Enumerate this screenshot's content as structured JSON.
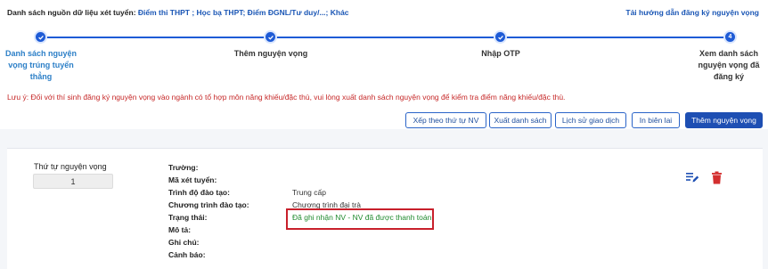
{
  "header": {
    "sources_label": "Danh sách nguồn dữ liệu xét tuyển:",
    "sources_value": "Điểm thi THPT ; Học bạ THPT; Điểm ĐGNL/Tư duy/...; Khác",
    "guide_link": "Tải hướng dẫn đăng ký nguyện vọng"
  },
  "steps": [
    {
      "label_lines": [
        "Danh sách nguyện",
        "vọng trúng tuyển",
        "thẳng"
      ],
      "state": "done"
    },
    {
      "label_lines": [
        "Thêm nguyện vọng"
      ],
      "state": "done"
    },
    {
      "label_lines": [
        "Nhập OTP"
      ],
      "state": "done"
    },
    {
      "label_lines": [
        "Xem danh sách",
        "nguyện vọng đã",
        "đăng ký"
      ],
      "state": "current",
      "number": "4"
    }
  ],
  "note": "Lưu ý: Đối với thí sinh đăng ký nguyện vọng vào ngành có tổ hợp môn năng khiếu/đặc thù, vui lòng xuất danh sách nguyện vọng để kiểm tra điểm năng khiếu/đặc thù.",
  "buttons": {
    "sort": "Xếp theo thứ tự NV",
    "export": "Xuất danh sách",
    "history": "Lịch sử giao dịch",
    "print": "In biên lai",
    "add": "Thêm nguyện vọng"
  },
  "wish": {
    "order_label": "Thứ tự nguyện vọng",
    "order_value": "1",
    "fields": [
      {
        "label": "Trường:",
        "value": ""
      },
      {
        "label": "Mã xét tuyển:",
        "value": ""
      },
      {
        "label": "Trình độ đào tạo:",
        "value": "Trung cấp"
      },
      {
        "label": "Chương trình đào tạo:",
        "value": "Chương trình đại trà"
      },
      {
        "label": "Trạng thái:",
        "value": "Đã ghi nhận NV - NV đã được thanh toán"
      },
      {
        "label": "Mô tả:",
        "value": ""
      },
      {
        "label": "Ghi chú:",
        "value": ""
      },
      {
        "label": "Cảnh báo:",
        "value": ""
      }
    ]
  },
  "colors": {
    "accent": "#1e5bd6",
    "status_green": "#1f8a2e",
    "warning_red": "#c62828",
    "highlight_box": "#c8202b",
    "delete_red": "#d32f2f"
  },
  "icons": {
    "edit": "edit-list-icon",
    "delete": "trash-icon",
    "step_done": "check-icon"
  }
}
